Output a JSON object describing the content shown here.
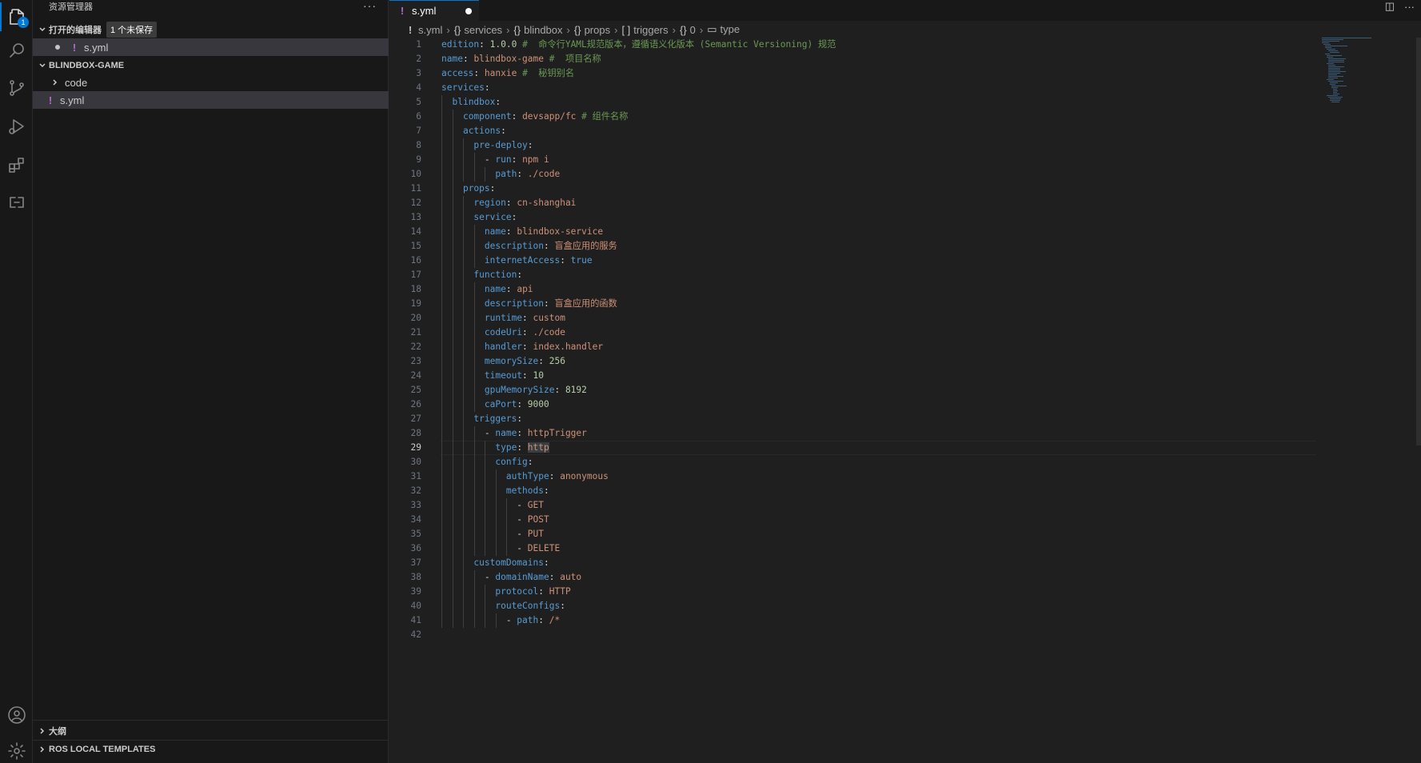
{
  "activity_bar": {
    "explorer_badge": "1"
  },
  "sidebar": {
    "title": "资源管理器",
    "more": "···",
    "open_editors": {
      "label": "打开的编辑器",
      "badge": "1 个未保存",
      "files": [
        {
          "name": "s.yml",
          "unsaved": true
        }
      ]
    },
    "project": {
      "label": "BLINDBOX-GAME",
      "items": [
        {
          "name": "code",
          "type": "folder"
        },
        {
          "name": "s.yml",
          "type": "file"
        }
      ]
    },
    "outline": {
      "label": "大纲"
    },
    "ros": {
      "label": "ROS LOCAL TEMPLATES"
    }
  },
  "editor": {
    "tab": {
      "name": "s.yml",
      "unsaved": true
    },
    "breadcrumb": [
      {
        "icon": "!",
        "label": "s.yml"
      },
      {
        "icon": "{}",
        "label": "services"
      },
      {
        "icon": "{}",
        "label": "blindbox"
      },
      {
        "icon": "{}",
        "label": "props"
      },
      {
        "icon": "[ ]",
        "label": "triggers"
      },
      {
        "icon": "{}",
        "label": "0"
      },
      {
        "icon": "▭",
        "label": "type"
      }
    ],
    "current_line": 29,
    "lines": [
      [
        [
          "k",
          "edition"
        ],
        [
          "p",
          ": "
        ],
        [
          "n",
          "1.0.0"
        ],
        [
          "c2",
          " #  命令行YAML规范版本，遵循语义化版本 (Semantic Versioning) 规范"
        ]
      ],
      [
        [
          "k",
          "name"
        ],
        [
          "p",
          ": "
        ],
        [
          "s",
          "blindbox-game"
        ],
        [
          "c2",
          " #  项目名称"
        ]
      ],
      [
        [
          "k",
          "access"
        ],
        [
          "p",
          ": "
        ],
        [
          "s",
          "hanxie"
        ],
        [
          "c2",
          " #  秘钥别名"
        ]
      ],
      [
        [
          "k",
          "services"
        ],
        [
          "p",
          ":"
        ]
      ],
      [
        [
          "p",
          "  "
        ],
        [
          "k",
          "blindbox"
        ],
        [
          "p",
          ":"
        ]
      ],
      [
        [
          "p",
          "    "
        ],
        [
          "k",
          "component"
        ],
        [
          "p",
          ": "
        ],
        [
          "s",
          "devsapp/fc"
        ],
        [
          "c2",
          " # 组件名称"
        ]
      ],
      [
        [
          "p",
          "    "
        ],
        [
          "k",
          "actions"
        ],
        [
          "p",
          ":"
        ]
      ],
      [
        [
          "p",
          "      "
        ],
        [
          "k",
          "pre-deploy"
        ],
        [
          "p",
          ":"
        ]
      ],
      [
        [
          "p",
          "        - "
        ],
        [
          "k",
          "run"
        ],
        [
          "p",
          ": "
        ],
        [
          "s",
          "npm i"
        ]
      ],
      [
        [
          "p",
          "          "
        ],
        [
          "k",
          "path"
        ],
        [
          "p",
          ": "
        ],
        [
          "s",
          "./code"
        ]
      ],
      [
        [
          "p",
          "    "
        ],
        [
          "k",
          "props"
        ],
        [
          "p",
          ":"
        ]
      ],
      [
        [
          "p",
          "      "
        ],
        [
          "k",
          "region"
        ],
        [
          "p",
          ": "
        ],
        [
          "s",
          "cn-shanghai"
        ]
      ],
      [
        [
          "p",
          "      "
        ],
        [
          "k",
          "service"
        ],
        [
          "p",
          ":"
        ]
      ],
      [
        [
          "p",
          "        "
        ],
        [
          "k",
          "name"
        ],
        [
          "p",
          ": "
        ],
        [
          "s",
          "blindbox-service"
        ]
      ],
      [
        [
          "p",
          "        "
        ],
        [
          "k",
          "description"
        ],
        [
          "p",
          ": "
        ],
        [
          "s",
          "盲盒应用的服务"
        ]
      ],
      [
        [
          "p",
          "        "
        ],
        [
          "k",
          "internetAccess"
        ],
        [
          "p",
          ": "
        ],
        [
          "b",
          "true"
        ]
      ],
      [
        [
          "p",
          "      "
        ],
        [
          "k",
          "function"
        ],
        [
          "p",
          ":"
        ]
      ],
      [
        [
          "p",
          "        "
        ],
        [
          "k",
          "name"
        ],
        [
          "p",
          ": "
        ],
        [
          "s",
          "api"
        ]
      ],
      [
        [
          "p",
          "        "
        ],
        [
          "k",
          "description"
        ],
        [
          "p",
          ": "
        ],
        [
          "s",
          "盲盒应用的函数"
        ]
      ],
      [
        [
          "p",
          "        "
        ],
        [
          "k",
          "runtime"
        ],
        [
          "p",
          ": "
        ],
        [
          "s",
          "custom"
        ]
      ],
      [
        [
          "p",
          "        "
        ],
        [
          "k",
          "codeUri"
        ],
        [
          "p",
          ": "
        ],
        [
          "s",
          "./code"
        ]
      ],
      [
        [
          "p",
          "        "
        ],
        [
          "k",
          "handler"
        ],
        [
          "p",
          ": "
        ],
        [
          "s",
          "index.handler"
        ]
      ],
      [
        [
          "p",
          "        "
        ],
        [
          "k",
          "memorySize"
        ],
        [
          "p",
          ": "
        ],
        [
          "n",
          "256"
        ]
      ],
      [
        [
          "p",
          "        "
        ],
        [
          "k",
          "timeout"
        ],
        [
          "p",
          ": "
        ],
        [
          "n",
          "10"
        ]
      ],
      [
        [
          "p",
          "        "
        ],
        [
          "k",
          "gpuMemorySize"
        ],
        [
          "p",
          ": "
        ],
        [
          "n",
          "8192"
        ]
      ],
      [
        [
          "p",
          "        "
        ],
        [
          "k",
          "caPort"
        ],
        [
          "p",
          ": "
        ],
        [
          "n",
          "9000"
        ]
      ],
      [
        [
          "p",
          "      "
        ],
        [
          "k",
          "triggers"
        ],
        [
          "p",
          ":"
        ]
      ],
      [
        [
          "p",
          "        - "
        ],
        [
          "k",
          "name"
        ],
        [
          "p",
          ": "
        ],
        [
          "s",
          "httpTrigger"
        ]
      ],
      [
        [
          "p",
          "          "
        ],
        [
          "k",
          "type"
        ],
        [
          "p",
          ": "
        ],
        [
          "s",
          "http"
        ]
      ],
      [
        [
          "p",
          "          "
        ],
        [
          "k",
          "config"
        ],
        [
          "p",
          ":"
        ]
      ],
      [
        [
          "p",
          "            "
        ],
        [
          "k",
          "authType"
        ],
        [
          "p",
          ": "
        ],
        [
          "s",
          "anonymous"
        ]
      ],
      [
        [
          "p",
          "            "
        ],
        [
          "k",
          "methods"
        ],
        [
          "p",
          ":"
        ]
      ],
      [
        [
          "p",
          "              - "
        ],
        [
          "s",
          "GET"
        ]
      ],
      [
        [
          "p",
          "              - "
        ],
        [
          "s",
          "POST"
        ]
      ],
      [
        [
          "p",
          "              - "
        ],
        [
          "s",
          "PUT"
        ]
      ],
      [
        [
          "p",
          "              - "
        ],
        [
          "s",
          "DELETE"
        ]
      ],
      [
        [
          "p",
          "      "
        ],
        [
          "k",
          "customDomains"
        ],
        [
          "p",
          ":"
        ]
      ],
      [
        [
          "p",
          "        - "
        ],
        [
          "k",
          "domainName"
        ],
        [
          "p",
          ": "
        ],
        [
          "s",
          "auto"
        ]
      ],
      [
        [
          "p",
          "          "
        ],
        [
          "k",
          "protocol"
        ],
        [
          "p",
          ": "
        ],
        [
          "s",
          "HTTP"
        ]
      ],
      [
        [
          "p",
          "          "
        ],
        [
          "k",
          "routeConfigs"
        ],
        [
          "p",
          ":"
        ]
      ],
      [
        [
          "p",
          "            - "
        ],
        [
          "k",
          "path"
        ],
        [
          "p",
          ": "
        ],
        [
          "s",
          "/*"
        ]
      ],
      []
    ]
  }
}
